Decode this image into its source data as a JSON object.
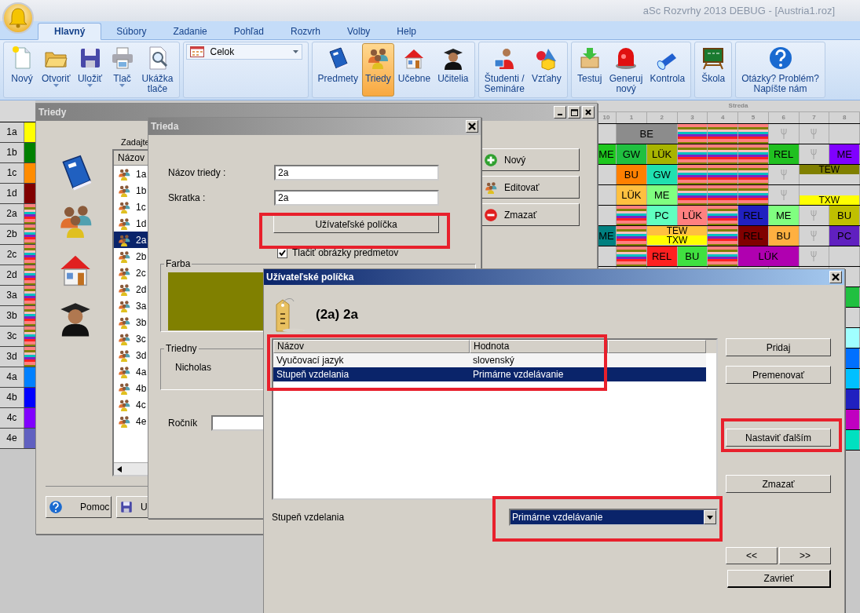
{
  "window": {
    "title": "aSc Rozvrhy 2013  DEBUG - [Austria1.roz]"
  },
  "ribbon": {
    "tabs": [
      {
        "label": "Hlavný",
        "selected": true
      },
      {
        "label": "Súbory",
        "selected": false
      },
      {
        "label": "Zadanie",
        "selected": false
      },
      {
        "label": "Pohľad",
        "selected": false
      },
      {
        "label": "Rozvrh",
        "selected": false
      },
      {
        "label": "Volby",
        "selected": false
      },
      {
        "label": "Help",
        "selected": false
      }
    ],
    "groups": [
      {
        "kind": "buttons",
        "buttons": [
          {
            "lines": [
              "Nový"
            ],
            "dropdown": false,
            "selected": false
          },
          {
            "lines": [
              "Otvoriť"
            ],
            "dropdown": true,
            "selected": false
          },
          {
            "lines": [
              "Uložiť"
            ],
            "dropdown": true,
            "selected": false
          },
          {
            "lines": [
              "Tlač"
            ],
            "dropdown": true,
            "selected": false
          },
          {
            "lines": [
              "Ukážka",
              "tlače"
            ],
            "dropdown": false,
            "selected": false
          }
        ]
      },
      {
        "kind": "combo",
        "value": "Celok"
      },
      {
        "kind": "buttons",
        "buttons": [
          {
            "lines": [
              "Predmety"
            ],
            "dropdown": false,
            "selected": false
          },
          {
            "lines": [
              "Triedy"
            ],
            "dropdown": false,
            "selected": true
          },
          {
            "lines": [
              "Učebne"
            ],
            "dropdown": false,
            "selected": false
          },
          {
            "lines": [
              "Učitelia"
            ],
            "dropdown": false,
            "selected": false
          }
        ]
      },
      {
        "kind": "buttons",
        "buttons": [
          {
            "lines": [
              "Študenti /",
              "Semináre"
            ],
            "dropdown": false,
            "selected": false
          },
          {
            "lines": [
              "Vzťahy"
            ],
            "dropdown": false,
            "selected": false
          }
        ]
      },
      {
        "kind": "buttons",
        "buttons": [
          {
            "lines": [
              "Testuj"
            ],
            "dropdown": false,
            "selected": false
          },
          {
            "lines": [
              "Generuj",
              "nový"
            ],
            "dropdown": false,
            "selected": false
          },
          {
            "lines": [
              "Kontrola"
            ],
            "dropdown": false,
            "selected": false
          }
        ]
      },
      {
        "kind": "buttons",
        "buttons": [
          {
            "lines": [
              "Škola"
            ],
            "dropdown": false,
            "selected": false
          }
        ]
      },
      {
        "kind": "buttons",
        "buttons": [
          {
            "lines": [
              "Otázky? Problém?",
              "Napíšte nám"
            ],
            "dropdown": false,
            "selected": false
          }
        ]
      }
    ]
  },
  "timetable": {
    "day": "Streda",
    "periods": [
      "10",
      "1",
      "2",
      "3",
      "4",
      "5",
      "6",
      "7",
      "8"
    ],
    "rows": [
      {
        "label": "1a",
        "edge": {
          "kind": "solid",
          "color": "#ffff00"
        },
        "cells": [
          {
            "kind": "empty"
          },
          {
            "kind": "lesson",
            "wide": true,
            "text": "BE",
            "color": "#8c8c8c"
          },
          {
            "kind": "striped"
          },
          {
            "kind": "striped"
          },
          {
            "kind": "striped"
          },
          {
            "kind": "meal"
          },
          {
            "kind": "meal"
          },
          {
            "kind": "empty"
          }
        ]
      },
      {
        "label": "1b",
        "edge": {
          "kind": "solid",
          "color": "#008000"
        },
        "cells": [
          {
            "kind": "lesson",
            "wide": false,
            "text": "ME",
            "color": "#1ec81e"
          },
          {
            "kind": "lesson",
            "wide": false,
            "text": "GW",
            "color": "#20c040"
          },
          {
            "kind": "lesson",
            "wide": false,
            "text": "LÜK",
            "color": "#a8b400"
          },
          {
            "kind": "striped"
          },
          {
            "kind": "striped"
          },
          {
            "kind": "striped"
          },
          {
            "kind": "lesson",
            "wide": false,
            "text": "REL",
            "color": "#20c020"
          },
          {
            "kind": "meal"
          },
          {
            "kind": "lesson",
            "wide": false,
            "text": "ME",
            "color": "#8000ff"
          }
        ]
      },
      {
        "label": "1c",
        "edge": {
          "kind": "solid",
          "color": "#ff8c00"
        },
        "cells": [
          {
            "kind": "empty"
          },
          {
            "kind": "lesson",
            "wide": false,
            "text": "BU",
            "color": "#ff8000"
          },
          {
            "kind": "lesson",
            "wide": false,
            "text": "GW",
            "color": "#20e0b0"
          },
          {
            "kind": "striped"
          },
          {
            "kind": "striped"
          },
          {
            "kind": "striped"
          },
          {
            "kind": "meal"
          },
          {
            "kind": "half_top",
            "text": "TEW",
            "color": "#808000"
          }
        ]
      },
      {
        "label": "1d",
        "edge": {
          "kind": "solid",
          "color": "#800000"
        },
        "cells": [
          {
            "kind": "empty"
          },
          {
            "kind": "lesson",
            "wide": false,
            "text": "LÜK",
            "color": "#ffc040"
          },
          {
            "kind": "lesson",
            "wide": false,
            "text": "ME",
            "color": "#80ff80"
          },
          {
            "kind": "striped"
          },
          {
            "kind": "striped"
          },
          {
            "kind": "striped"
          },
          {
            "kind": "meal"
          },
          {
            "kind": "half_bottom",
            "text": "TXW",
            "color": "#ffff00"
          }
        ]
      },
      {
        "label": "2a",
        "edge": {
          "kind": "striped"
        },
        "cells": [
          {
            "kind": "empty"
          },
          {
            "kind": "striped"
          },
          {
            "kind": "lesson",
            "wide": false,
            "text": "PC",
            "color": "#60ffc0"
          },
          {
            "kind": "lesson",
            "wide": false,
            "text": "LÜK",
            "color": "#ff8080"
          },
          {
            "kind": "striped"
          },
          {
            "kind": "lesson",
            "wide": false,
            "text": "REL",
            "color": "#2020c0"
          },
          {
            "kind": "lesson",
            "wide": false,
            "text": "ME",
            "color": "#80ff80"
          },
          {
            "kind": "meal"
          },
          {
            "kind": "lesson",
            "wide": false,
            "text": "BU",
            "color": "#c0c000"
          }
        ]
      },
      {
        "label": "2b",
        "edge": {
          "kind": "striped"
        },
        "cells": [
          {
            "kind": "lesson",
            "wide": false,
            "text": "ME",
            "color": "#008080"
          },
          {
            "kind": "striped"
          },
          {
            "kind": "pair",
            "lessons": [
              {
                "text": "TEW",
                "color": "#ffc040"
              },
              {
                "text": "TXW",
                "color": "#ffff00"
              }
            ]
          },
          {
            "kind": "striped"
          },
          {
            "kind": "lesson",
            "wide": false,
            "text": "REL",
            "color": "#800000"
          },
          {
            "kind": "lesson",
            "wide": false,
            "text": "BU",
            "color": "#ffb040"
          },
          {
            "kind": "meal"
          },
          {
            "kind": "lesson",
            "wide": false,
            "text": "PC",
            "color": "#6020c0"
          }
        ]
      },
      {
        "label": "2c",
        "edge": {
          "kind": "striped"
        },
        "cells": [
          {
            "kind": "empty"
          },
          {
            "kind": "striped"
          },
          {
            "kind": "lesson",
            "wide": false,
            "text": "REL",
            "color": "#ff2020"
          },
          {
            "kind": "lesson",
            "wide": false,
            "text": "BU",
            "color": "#40e040"
          },
          {
            "kind": "striped"
          },
          {
            "kind": "lesson",
            "wide": true,
            "text": "LÜK",
            "color": "#b000b0"
          },
          {
            "kind": "meal"
          },
          {
            "kind": "empty"
          }
        ]
      },
      {
        "label": "2d",
        "edge": {
          "kind": "striped"
        },
        "cells": [
          {
            "kind": "empty"
          },
          {
            "kind": "empty"
          },
          {
            "kind": "empty"
          },
          {
            "kind": "empty"
          },
          {
            "kind": "empty"
          },
          {
            "kind": "empty"
          },
          {
            "kind": "empty"
          },
          {
            "kind": "empty"
          },
          {
            "kind": "empty"
          }
        ]
      },
      {
        "label": "3a",
        "edge": {
          "kind": "striped"
        },
        "cells": [
          {
            "kind": "empty"
          },
          {
            "kind": "empty"
          },
          {
            "kind": "empty"
          },
          {
            "kind": "empty"
          },
          {
            "kind": "empty"
          },
          {
            "kind": "empty"
          },
          {
            "kind": "empty"
          },
          {
            "kind": "empty"
          },
          {
            "kind": "block",
            "color": "#20c040"
          }
        ]
      },
      {
        "label": "3b",
        "edge": {
          "kind": "striped"
        },
        "cells": [
          {
            "kind": "empty"
          },
          {
            "kind": "empty"
          },
          {
            "kind": "empty"
          },
          {
            "kind": "empty"
          },
          {
            "kind": "empty"
          },
          {
            "kind": "empty"
          },
          {
            "kind": "empty"
          },
          {
            "kind": "empty"
          },
          {
            "kind": "empty"
          }
        ]
      },
      {
        "label": "3c",
        "edge": {
          "kind": "striped"
        },
        "cells": [
          {
            "kind": "empty"
          },
          {
            "kind": "empty"
          },
          {
            "kind": "empty"
          },
          {
            "kind": "empty"
          },
          {
            "kind": "empty"
          },
          {
            "kind": "empty"
          },
          {
            "kind": "empty"
          },
          {
            "kind": "empty"
          },
          {
            "kind": "block",
            "color": "#a0ffff"
          }
        ]
      },
      {
        "label": "3d",
        "edge": {
          "kind": "striped"
        },
        "cells": [
          {
            "kind": "empty"
          },
          {
            "kind": "empty"
          },
          {
            "kind": "empty"
          },
          {
            "kind": "empty"
          },
          {
            "kind": "empty"
          },
          {
            "kind": "empty"
          },
          {
            "kind": "empty"
          },
          {
            "kind": "empty"
          },
          {
            "kind": "block",
            "color": "#0070ff"
          }
        ]
      },
      {
        "label": "4a",
        "edge": {
          "kind": "solid",
          "color": "#0080ff"
        },
        "cells": [
          {
            "kind": "empty"
          },
          {
            "kind": "empty"
          },
          {
            "kind": "empty"
          },
          {
            "kind": "empty"
          },
          {
            "kind": "empty"
          },
          {
            "kind": "empty"
          },
          {
            "kind": "empty"
          },
          {
            "kind": "empty"
          },
          {
            "kind": "block",
            "color": "#00c0ff"
          }
        ]
      },
      {
        "label": "4b",
        "edge": {
          "kind": "solid",
          "color": "#0000ff"
        },
        "cells": [
          {
            "kind": "empty"
          },
          {
            "kind": "empty"
          },
          {
            "kind": "empty"
          },
          {
            "kind": "empty"
          },
          {
            "kind": "empty"
          },
          {
            "kind": "empty"
          },
          {
            "kind": "empty"
          },
          {
            "kind": "empty"
          },
          {
            "kind": "block",
            "color": "#2020c0"
          }
        ]
      },
      {
        "label": "4c",
        "edge": {
          "kind": "solid",
          "color": "#8000ff"
        },
        "cells": [
          {
            "kind": "empty"
          },
          {
            "kind": "empty"
          },
          {
            "kind": "empty"
          },
          {
            "kind": "empty"
          },
          {
            "kind": "empty"
          },
          {
            "kind": "empty"
          },
          {
            "kind": "empty"
          },
          {
            "kind": "empty"
          },
          {
            "kind": "block",
            "color": "#c000c0"
          }
        ]
      },
      {
        "label": "4e",
        "edge": {
          "kind": "solid",
          "color": "#6060c0"
        },
        "cells": [
          {
            "kind": "empty"
          },
          {
            "kind": "empty"
          },
          {
            "kind": "empty"
          },
          {
            "kind": "empty"
          },
          {
            "kind": "empty"
          },
          {
            "kind": "empty"
          },
          {
            "kind": "empty"
          },
          {
            "kind": "empty"
          },
          {
            "kind": "block",
            "color": "#00e0c0"
          }
        ]
      }
    ]
  },
  "triedy": {
    "title": "Triedy",
    "prompt": "Zadajte",
    "list_header": "Názov",
    "classes": [
      {
        "name": "1a",
        "selected": false
      },
      {
        "name": "1b",
        "selected": false
      },
      {
        "name": "1c",
        "selected": false
      },
      {
        "name": "1d",
        "selected": false
      },
      {
        "name": "2a",
        "selected": true
      },
      {
        "name": "2b",
        "selected": false
      },
      {
        "name": "2c",
        "selected": false
      },
      {
        "name": "2d",
        "selected": false
      },
      {
        "name": "3a",
        "selected": false
      },
      {
        "name": "3b",
        "selected": false
      },
      {
        "name": "3c",
        "selected": false
      },
      {
        "name": "3d",
        "selected": false
      },
      {
        "name": "4a",
        "selected": false
      },
      {
        "name": "4b",
        "selected": false
      },
      {
        "name": "4c",
        "selected": false
      },
      {
        "name": "4e",
        "selected": false
      }
    ],
    "actions": [
      "Nový",
      "Editovať",
      "Zmazať"
    ],
    "footer": [
      "Pomoc",
      "U"
    ]
  },
  "trieda": {
    "title": "Trieda",
    "fields": [
      {
        "label": "Názov triedy :",
        "value": "2a"
      },
      {
        "label": "Skratka :",
        "value": "2a"
      }
    ],
    "custom_fields_button": "Užívateľské políčka",
    "checkbox": {
      "label": "Tlačiť obrázky predmetov",
      "checked": true
    },
    "color_group": {
      "legend": "Farba",
      "color": "#808000"
    },
    "teacher_group": {
      "legend": "Triedny",
      "name": "Nicholas"
    },
    "year": {
      "label": "Ročník"
    }
  },
  "custom_fields": {
    "title": "Užívateľské políčka",
    "heading": "(2a) 2a",
    "columns": [
      "Názov",
      "Hodnota"
    ],
    "rows": [
      {
        "name": "Vyučovací jazyk",
        "value": "slovenský",
        "selected": false
      },
      {
        "name": "Stupeň vzdelania",
        "value": "Primárne vzdelávanie",
        "selected": true
      }
    ],
    "actions": [
      "Pridaj",
      "Premenovať",
      "Nastaviť ďalším",
      "Zmazať"
    ],
    "value_label": "Stupeň vzdelania",
    "value_select": "Primárne vzdelávanie",
    "nav": [
      "<<",
      ">>"
    ],
    "close": "Zavrieť"
  }
}
